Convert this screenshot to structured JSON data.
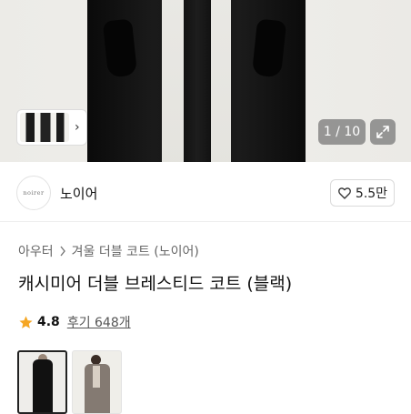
{
  "gallery": {
    "counter": "1 / 10",
    "icons": {
      "thumbnails_chevron": "chevron-right-icon",
      "expand": "expand-icon"
    }
  },
  "seller": {
    "logo_text": "noirer",
    "name": "노이어"
  },
  "like": {
    "count": "5.5만",
    "icon": "heart-outline-icon"
  },
  "breadcrumb": {
    "parent": "아우터",
    "current": "겨울 더블 코트 (노이어)"
  },
  "product": {
    "title": "캐시미어 더블 브레스티드 코트 (블랙)"
  },
  "rating": {
    "value": "4.8",
    "reviews": "후기 648개",
    "star_color": "#f5a623"
  },
  "options": [
    {
      "name": "black",
      "selected": true
    },
    {
      "name": "grey",
      "selected": false
    }
  ]
}
